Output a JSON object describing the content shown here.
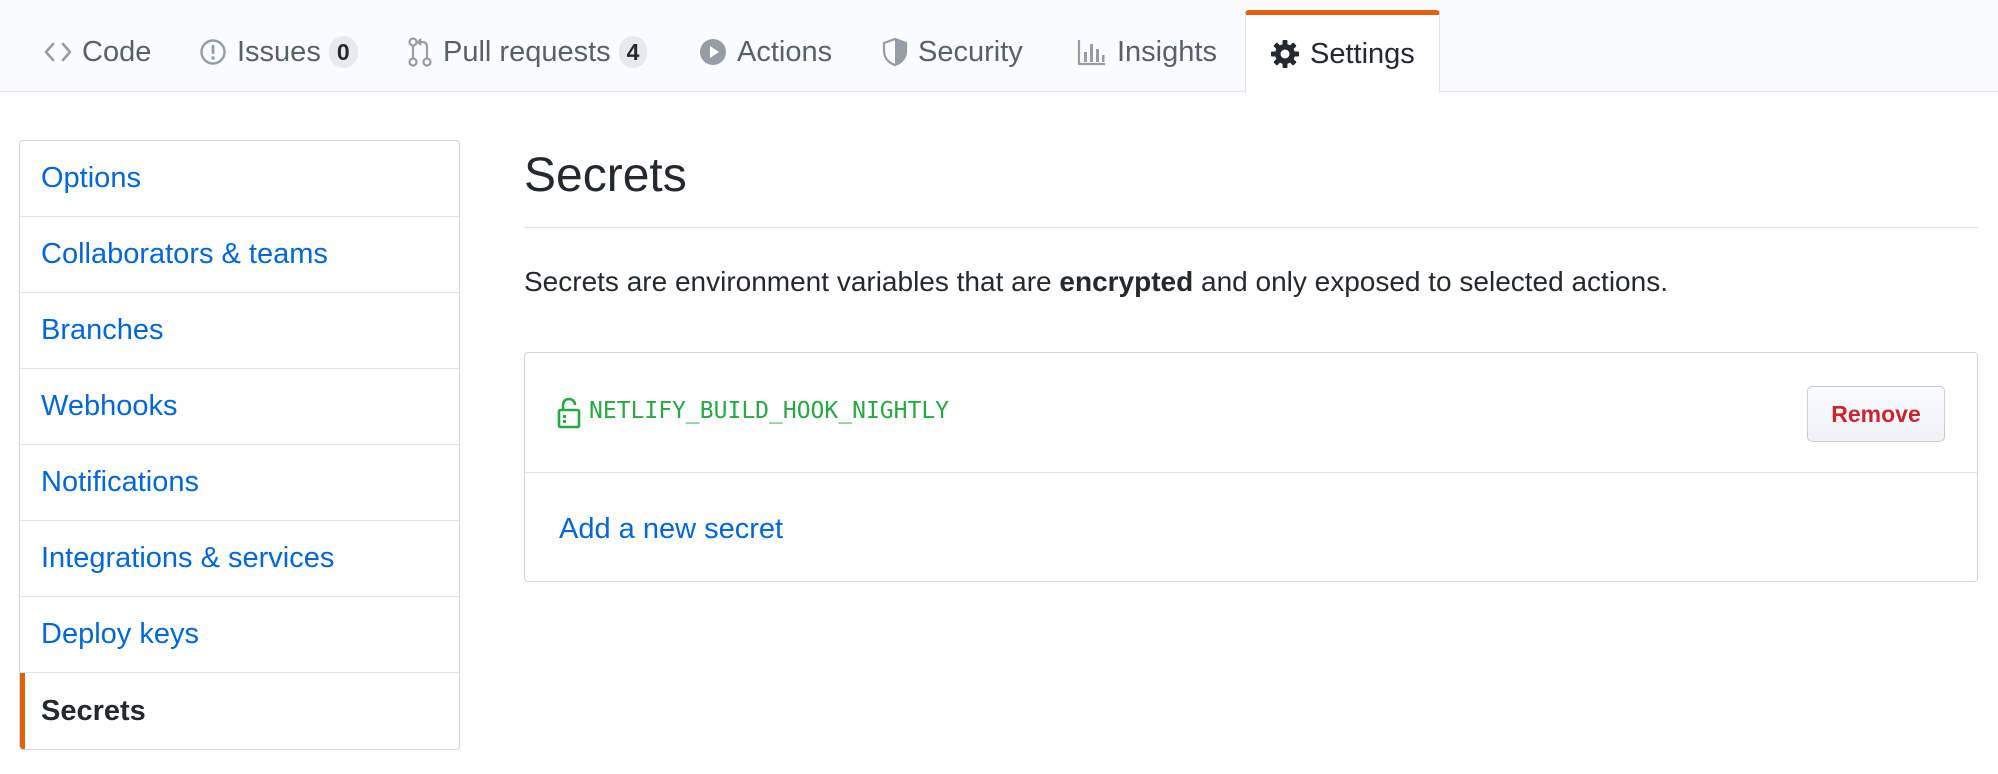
{
  "tabs": {
    "code": {
      "label": "Code"
    },
    "issues": {
      "label": "Issues",
      "count": "0"
    },
    "pull_requests": {
      "label": "Pull requests",
      "count": "4"
    },
    "actions": {
      "label": "Actions"
    },
    "security": {
      "label": "Security"
    },
    "insights": {
      "label": "Insights"
    },
    "settings": {
      "label": "Settings",
      "selected": true
    }
  },
  "sidebar": {
    "items": [
      {
        "label": "Options"
      },
      {
        "label": "Collaborators & teams"
      },
      {
        "label": "Branches"
      },
      {
        "label": "Webhooks"
      },
      {
        "label": "Notifications"
      },
      {
        "label": "Integrations & services"
      },
      {
        "label": "Deploy keys"
      },
      {
        "label": "Secrets",
        "selected": true
      }
    ]
  },
  "main": {
    "title": "Secrets",
    "description_before": "Secrets are environment variables that are ",
    "description_bold": "encrypted",
    "description_after": " and only exposed to selected actions.",
    "secrets": [
      {
        "name": "NETLIFY_BUILD_HOOK_NIGHTLY",
        "remove_label": "Remove"
      }
    ],
    "add_secret_label": "Add a new secret"
  },
  "colors": {
    "link": "#0366d6",
    "text": "#24292e",
    "muted": "#586069",
    "accent": "#e36209",
    "secret_name": "#28a745",
    "danger": "#cb2431"
  }
}
